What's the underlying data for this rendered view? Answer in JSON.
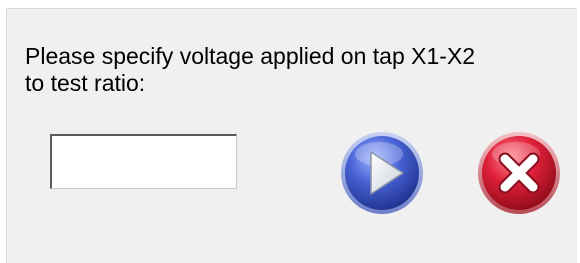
{
  "dialog": {
    "prompt": "Please specify voltage applied on tap X1-X2\n to test ratio:",
    "voltage_input": {
      "value": "",
      "placeholder": ""
    },
    "buttons": {
      "confirm_icon": "play-arrow-icon",
      "cancel_icon": "red-x-icon"
    },
    "colors": {
      "confirm_blue": "#3a55c8",
      "cancel_red": "#d8142a",
      "background": "#f0f0f0"
    }
  }
}
